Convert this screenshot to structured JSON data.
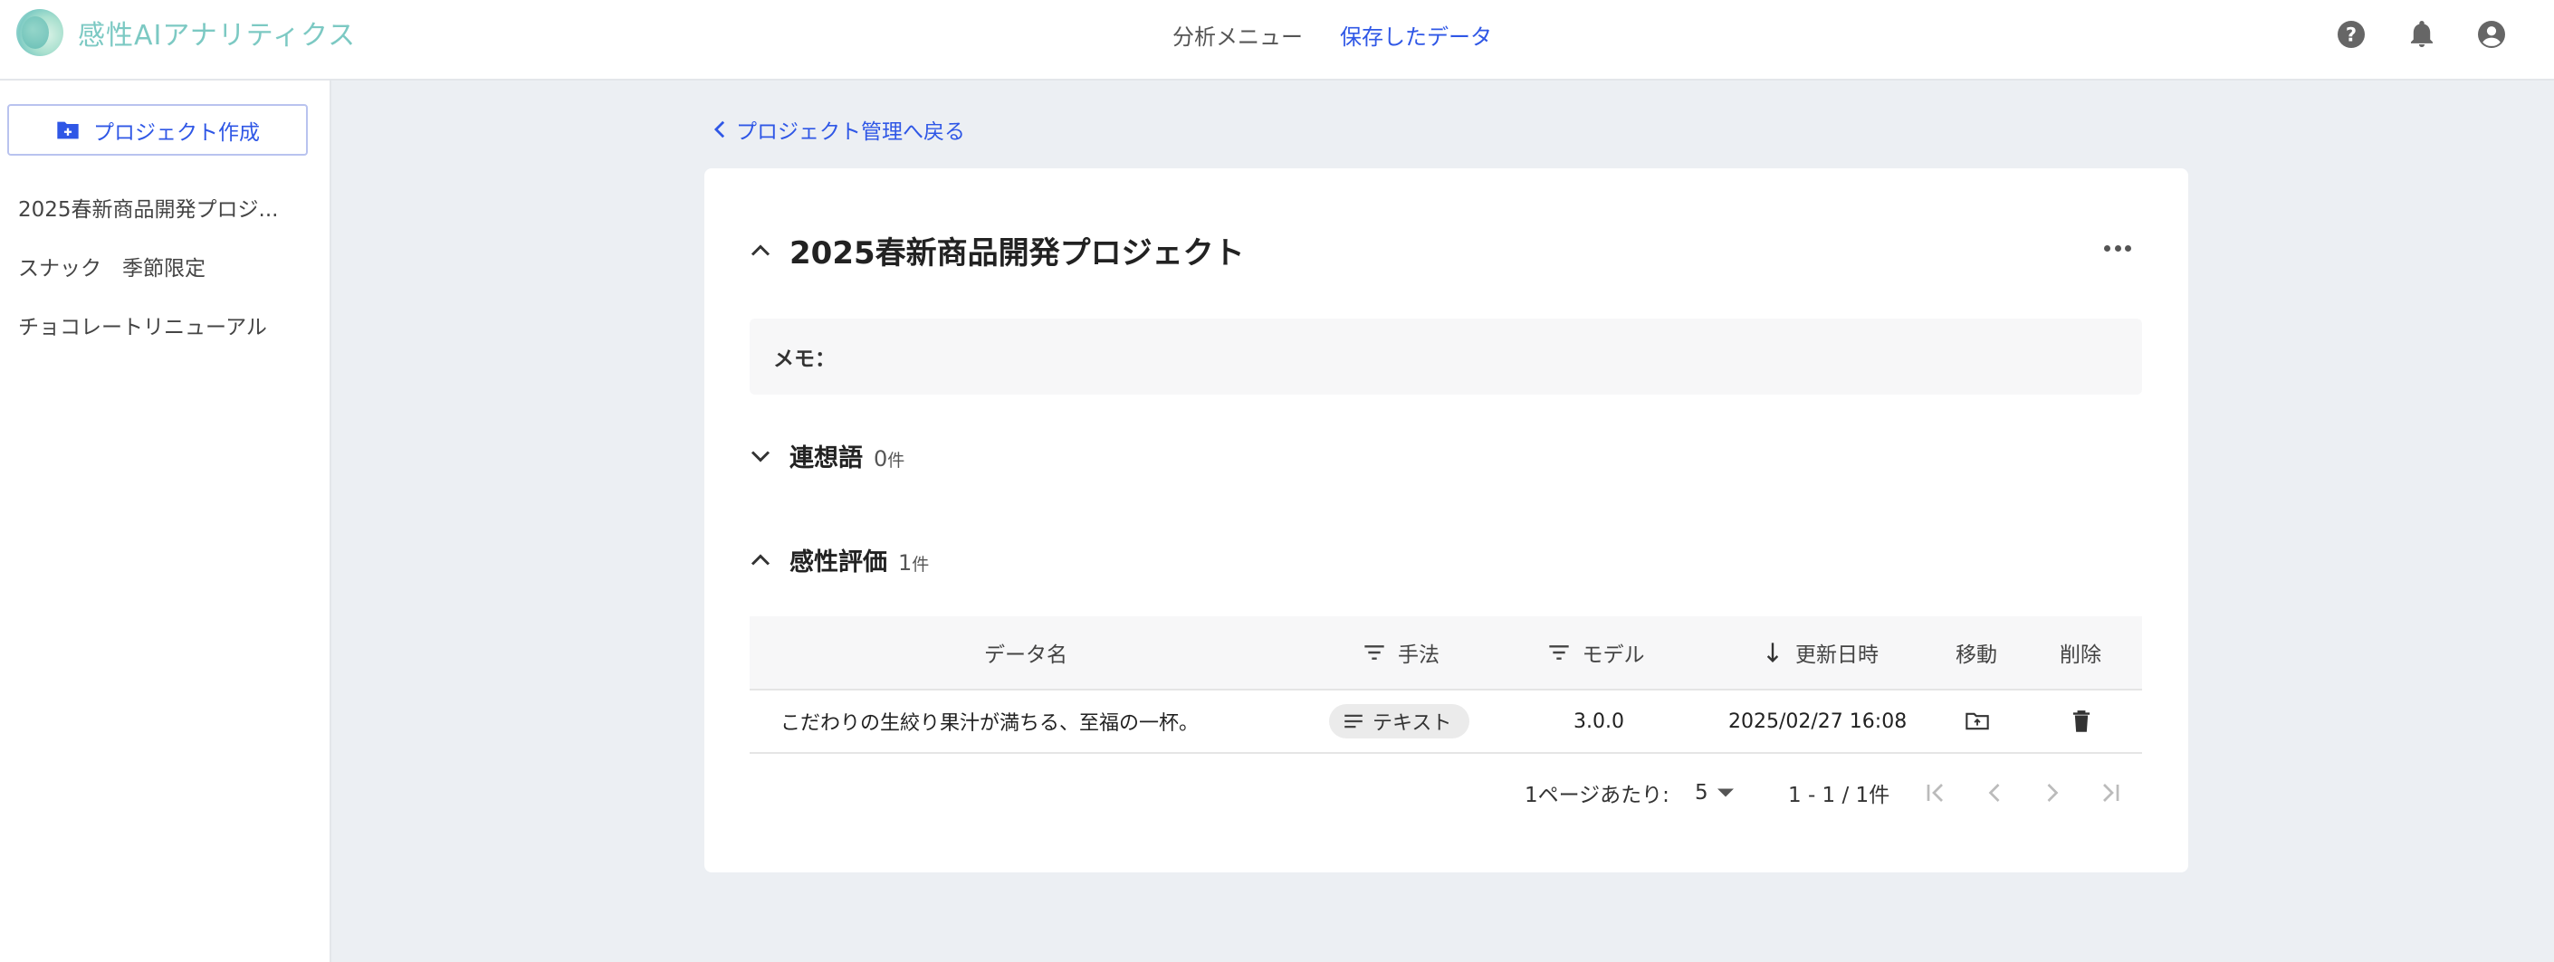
{
  "app": {
    "title": "感性AIアナリティクス"
  },
  "nav": {
    "analysis_menu": "分析メニュー",
    "saved_data": "保存したデータ",
    "active_color": "#2f57e6"
  },
  "header_icons": [
    "help-icon",
    "bell-icon",
    "account-icon"
  ],
  "sidebar": {
    "create_label": "プロジェクト作成",
    "items": [
      {
        "label": "2025春新商品開発プロジ..."
      },
      {
        "label": "スナック　季節限定"
      },
      {
        "label": "チョコレートリニューアル"
      }
    ]
  },
  "main": {
    "back_label": "プロジェクト管理へ戻る",
    "project_title": "2025春新商品開発プロジェクト",
    "memo_label": "メモ：",
    "sections": [
      {
        "title": "連想語",
        "count": "0",
        "unit": "件",
        "expanded": false
      },
      {
        "title": "感性評価",
        "count": "1",
        "unit": "件",
        "expanded": true
      }
    ],
    "table": {
      "headers": {
        "name": "データ名",
        "method": "手法",
        "model": "モデル",
        "updated": "更新日時",
        "move": "移動",
        "delete": "削除"
      },
      "rows": [
        {
          "name": "こだわりの生絞り果汁が満ちる、至福の一杯。",
          "method": "テキスト",
          "model": "3.0.0",
          "updated": "2025/02/27 16:08"
        }
      ]
    },
    "pagination": {
      "per_page_label": "1ページあたり:",
      "per_page_value": "5",
      "range": "1 - 1 / 1件"
    }
  }
}
